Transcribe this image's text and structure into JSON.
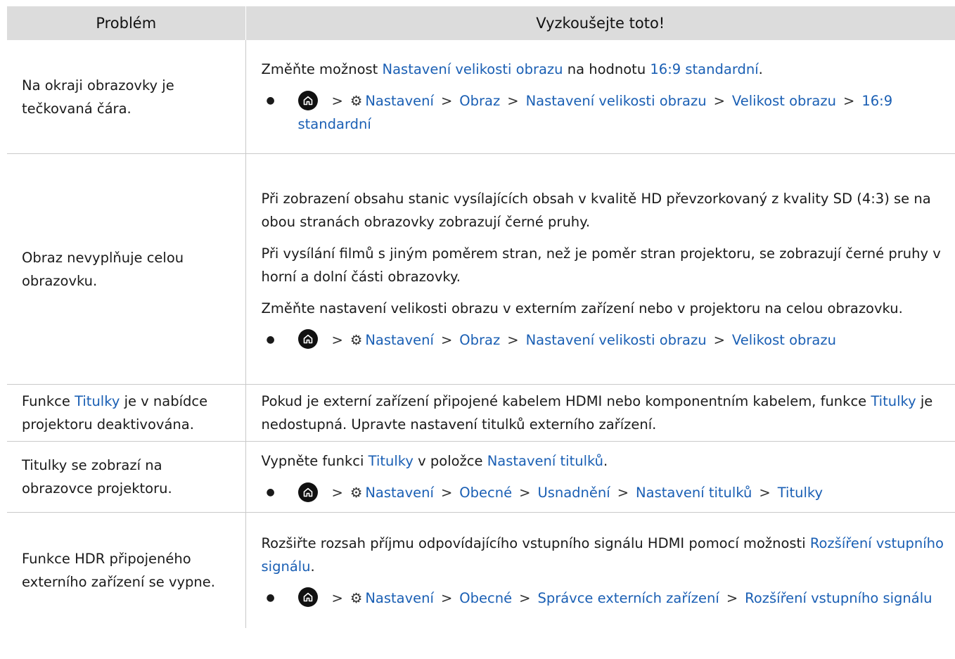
{
  "header": {
    "col_problem": "Problém",
    "col_solution": "Vyzkoušejte toto!"
  },
  "rows": [
    {
      "problem": [
        {
          "text": "Na okraji obrazovky je tečkovaná čára.",
          "link": false
        }
      ],
      "blocks": [
        {
          "type": "p",
          "segments": [
            {
              "text": "Změňte možnost ",
              "link": false
            },
            {
              "text": "Nastavení velikosti obrazu",
              "link": true
            },
            {
              "text": " na hodnotu ",
              "link": false
            },
            {
              "text": "16:9 standardní",
              "link": true
            },
            {
              "text": ".",
              "link": false
            }
          ]
        },
        {
          "type": "path",
          "items": [
            "Nastavení",
            "Obraz",
            "Nastavení velikosti obrazu",
            "Velikost obrazu",
            "16:9 standardní"
          ]
        }
      ]
    },
    {
      "problem": [
        {
          "text": "Obraz nevyplňuje celou obrazovku.",
          "link": false
        }
      ],
      "blocks": [
        {
          "type": "p",
          "segments": [
            {
              "text": "Při zobrazení obsahu stanic vysílajících obsah v kvalitě HD převzorkovaný z kvality SD (4:3) se na obou stranách obrazovky zobrazují černé pruhy.",
              "link": false
            }
          ]
        },
        {
          "type": "p",
          "segments": [
            {
              "text": "Při vysílání filmů s jiným poměrem stran, než je poměr stran projektoru, se zobrazují černé pruhy v horní a dolní části obrazovky.",
              "link": false
            }
          ]
        },
        {
          "type": "p",
          "segments": [
            {
              "text": "Změňte nastavení velikosti obrazu v externím zařízení nebo v projektoru na celou obrazovku.",
              "link": false
            }
          ]
        },
        {
          "type": "path",
          "items": [
            "Nastavení",
            "Obraz",
            "Nastavení velikosti obrazu",
            "Velikost obrazu"
          ]
        }
      ]
    },
    {
      "problem": [
        {
          "text": "Funkce ",
          "link": false
        },
        {
          "text": "Titulky",
          "link": true
        },
        {
          "text": " je v nabídce projektoru deaktivována.",
          "link": false
        }
      ],
      "blocks": [
        {
          "type": "p",
          "segments": [
            {
              "text": "Pokud je externí zařízení připojené kabelem HDMI nebo komponentním kabelem, funkce ",
              "link": false
            },
            {
              "text": "Titulky",
              "link": true
            },
            {
              "text": " je nedostupná. Upravte nastavení titulků externího zařízení.",
              "link": false
            }
          ]
        }
      ]
    },
    {
      "problem": [
        {
          "text": "Titulky se zobrazí na obrazovce projektoru.",
          "link": false
        }
      ],
      "blocks": [
        {
          "type": "p",
          "segments": [
            {
              "text": "Vypněte funkci ",
              "link": false
            },
            {
              "text": "Titulky",
              "link": true
            },
            {
              "text": " v položce ",
              "link": false
            },
            {
              "text": "Nastavení titulků",
              "link": true
            },
            {
              "text": ".",
              "link": false
            }
          ]
        },
        {
          "type": "path",
          "items": [
            "Nastavení",
            "Obecné",
            "Usnadnění",
            "Nastavení titulků",
            "Titulky"
          ]
        }
      ]
    },
    {
      "problem": [
        {
          "text": "Funkce HDR připojeného externího zařízení se vypne.",
          "link": false
        }
      ],
      "blocks": [
        {
          "type": "p",
          "segments": [
            {
              "text": "Rozšiřte rozsah příjmu odpovídajícího vstupního signálu HDMI pomocí možnosti ",
              "link": false
            },
            {
              "text": "Rozšíření vstupního signálu",
              "link": true
            },
            {
              "text": ".",
              "link": false
            }
          ]
        },
        {
          "type": "path",
          "items": [
            "Nastavení",
            "Obecné",
            "Správce externích zařízení",
            "Rozšíření vstupního signálu"
          ]
        }
      ]
    }
  ],
  "icons": {
    "home": "home-icon",
    "gear": "gear-icon",
    "separator": "chevron-right-icon",
    "bullet": "bullet-dot"
  },
  "colors": {
    "link": "#1a5fb4",
    "header_bg": "#dcdcdc",
    "grid": "#c9c9c9"
  }
}
